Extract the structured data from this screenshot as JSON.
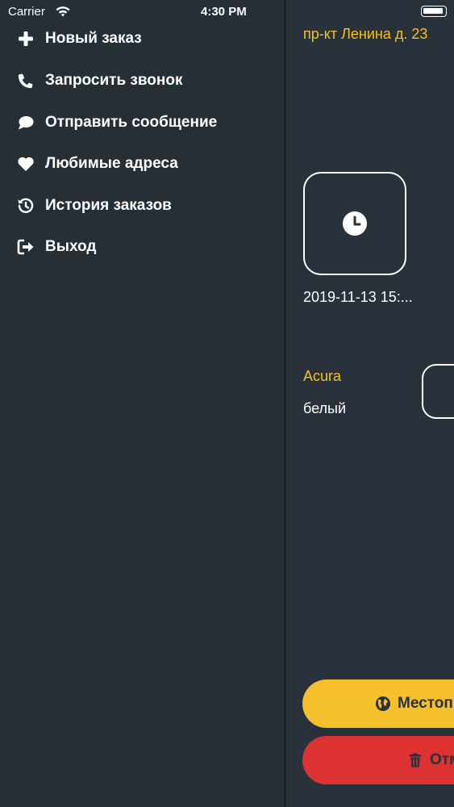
{
  "status_bar": {
    "carrier": "Carrier",
    "time": "4:30 PM"
  },
  "menu": {
    "items": [
      {
        "label": "Новый заказ",
        "icon": "plus-icon"
      },
      {
        "label": "Запросить звонок",
        "icon": "phone-icon"
      },
      {
        "label": "Отправить сообщение",
        "icon": "comment-icon"
      },
      {
        "label": "Любимые адреса",
        "icon": "heart-icon"
      },
      {
        "label": "История заказов",
        "icon": "history-icon"
      },
      {
        "label": "Выход",
        "icon": "sign-out-icon"
      }
    ]
  },
  "order": {
    "address": "пр-кт Ленина д. 23",
    "datetime": "2019-11-13 15:...",
    "car_brand": "Acura",
    "car_color": "белый"
  },
  "buttons": {
    "location_label": "Местоп",
    "cancel_label": "Отм"
  },
  "colors": {
    "background": "#262e36",
    "accent": "#f6c02b",
    "danger": "#dc3232"
  }
}
